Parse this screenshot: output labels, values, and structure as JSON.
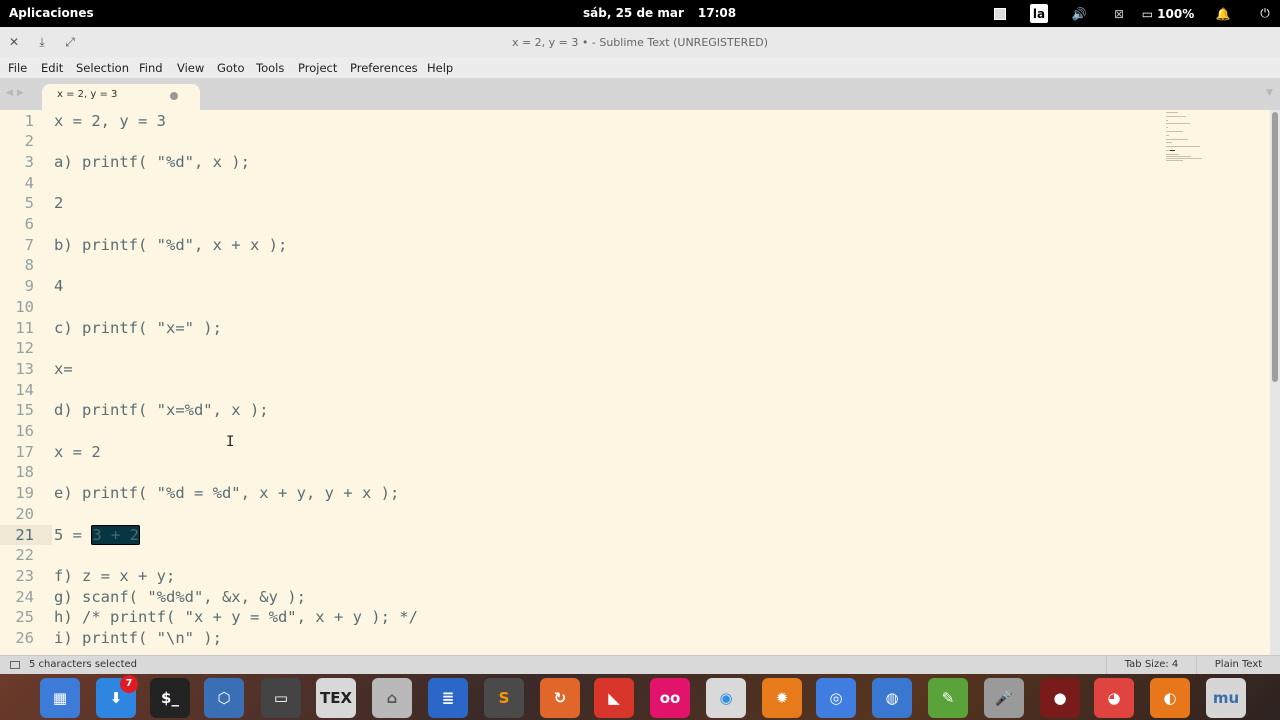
{
  "topbar": {
    "apps_label": "Aplicaciones",
    "date": "sáb, 25 de mar",
    "time": "17:08",
    "keyboard_layout": "la",
    "battery": "100%"
  },
  "window": {
    "title": "x = 2, y = 3 • - Sublime Text (UNREGISTERED)"
  },
  "menu": {
    "file": "File",
    "edit": "Edit",
    "selection": "Selection",
    "find": "Find",
    "view": "View",
    "goto": "Goto",
    "tools": "Tools",
    "project": "Project",
    "preferences": "Preferences",
    "help": "Help"
  },
  "tab": {
    "label": "x = 2, y = 3"
  },
  "editor": {
    "active_line": 21,
    "lines": [
      "x = 2, y = 3",
      "",
      "a) printf( \"%d\", x );",
      "",
      "2",
      "",
      "b) printf( \"%d\", x + x );",
      "",
      "4",
      "",
      "c) printf( \"x=\" );",
      "",
      "x=",
      "",
      "d) printf( \"x=%d\", x );",
      "",
      "x = 2",
      "",
      "e) printf( \"%d = %d\", x + y, y + x );",
      "",
      "5 = ",
      "",
      "f) z = x + y;",
      "g) scanf( \"%d%d\", &x, &y );",
      "h) /* printf( \"x + y = %d\", x + y ); */",
      "i) printf( \"\\n\" );"
    ],
    "selected_text": "3 + 2",
    "line_numbers": [
      "1",
      "2",
      "3",
      "4",
      "5",
      "6",
      "7",
      "8",
      "9",
      "10",
      "11",
      "12",
      "13",
      "14",
      "15",
      "16",
      "17",
      "18",
      "19",
      "20",
      "21",
      "22",
      "23",
      "24",
      "25",
      "26"
    ]
  },
  "status": {
    "selection": "5 characters selected",
    "tab_size": "Tab Size: 4",
    "syntax": "Plain Text"
  },
  "dock": {
    "downloads_badge": "7",
    "apps": [
      "workspaces-icon",
      "downloads-icon",
      "terminal-icon",
      "virtualbox-icon",
      "screencast-icon",
      "tex-icon",
      "files-icon",
      "writer-icon",
      "sublime-icon",
      "sync-icon",
      "pdf-icon",
      "flickr-icon",
      "toggle-icon",
      "burst-icon",
      "chromium-icon",
      "globe-icon",
      "editor-icon",
      "microphone-icon",
      "rec-icon",
      "chrome-icon",
      "firefox-icon",
      "mu-icon"
    ]
  },
  "colors": {
    "editor_bg": "#fdf6e3",
    "selection_bg": "#073642",
    "gutter_text": "#93a1a1"
  }
}
